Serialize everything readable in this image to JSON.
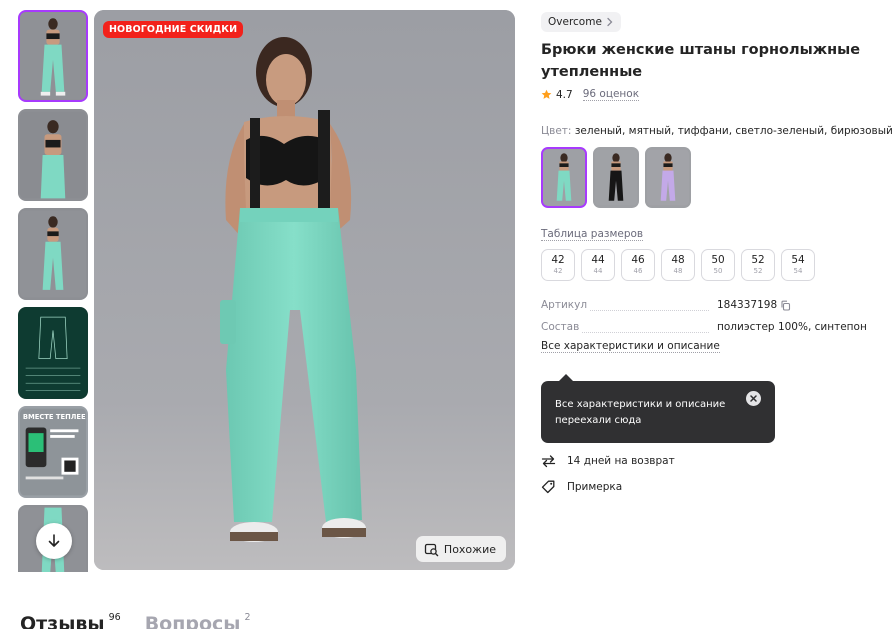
{
  "gallery": {
    "badge": "НОВОГОДНИЕ СКИДКИ",
    "similar_label": "Похожие",
    "promo_thumb_text": "ВМЕСТЕ ТЕПЛЕЕ"
  },
  "product": {
    "brand": "Overcome",
    "title": "Брюки женские штаны горнолыжные утепленные",
    "rating": "4.7",
    "reviews_count": "96 оценок",
    "color_label": "Цвет:",
    "color_value": "зеленый, мятный, тиффани, светло-зеленый, бирюзовый",
    "size_table_link": "Таблица размеров",
    "sizes": [
      {
        "main": "42",
        "sub": "42"
      },
      {
        "main": "44",
        "sub": "44"
      },
      {
        "main": "46",
        "sub": "46"
      },
      {
        "main": "48",
        "sub": "48"
      },
      {
        "main": "50",
        "sub": "50"
      },
      {
        "main": "52",
        "sub": "52"
      },
      {
        "main": "54",
        "sub": "54"
      }
    ],
    "specs": [
      {
        "key": "Артикул",
        "value": "184337198"
      },
      {
        "key": "Состав",
        "value": "полиэстер 100%, синтепон"
      }
    ],
    "all_chars_link": "Все характеристики и описание"
  },
  "tooltip": {
    "text": "Все характеристики и описание переехали сюда"
  },
  "features": {
    "return_label": "14 дней на возврат",
    "fitting_label": "Примерка"
  },
  "tabs": [
    {
      "label": "Отзывы",
      "count": "96"
    },
    {
      "label": "Вопросы",
      "count": "2"
    }
  ],
  "colors": {
    "accent": "#a73afd",
    "badge": "#f2211b",
    "star": "#ff9f1c",
    "mint": "#7fd9c3"
  }
}
